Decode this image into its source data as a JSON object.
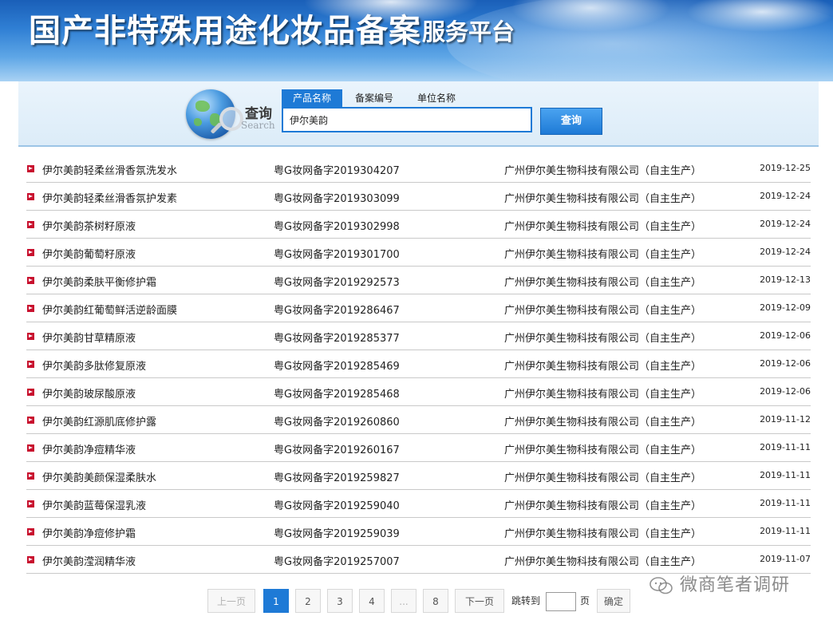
{
  "header": {
    "title": "国产非特殊用途化妆品备案",
    "subtitle": "服务平台"
  },
  "search": {
    "label": "查询",
    "label_en": "Search",
    "tabs": [
      {
        "label": "产品名称",
        "active": true
      },
      {
        "label": "备案编号",
        "active": false
      },
      {
        "label": "单位名称",
        "active": false
      }
    ],
    "query": "伊尔美韵",
    "button_label": "查询"
  },
  "results": [
    {
      "name": "伊尔美韵轻柔丝滑香氛洗发水",
      "code": "粤G妆网备字2019304207",
      "company": "广州伊尔美生物科技有限公司（自主生产）",
      "date": "2019-12-25"
    },
    {
      "name": "伊尔美韵轻柔丝滑香氛护发素",
      "code": "粤G妆网备字2019303099",
      "company": "广州伊尔美生物科技有限公司（自主生产）",
      "date": "2019-12-24"
    },
    {
      "name": "伊尔美韵茶树籽原液",
      "code": "粤G妆网备字2019302998",
      "company": "广州伊尔美生物科技有限公司（自主生产）",
      "date": "2019-12-24"
    },
    {
      "name": "伊尔美韵葡萄籽原液",
      "code": "粤G妆网备字2019301700",
      "company": "广州伊尔美生物科技有限公司（自主生产）",
      "date": "2019-12-24"
    },
    {
      "name": "伊尔美韵柔肤平衡修护霜",
      "code": "粤G妆网备字2019292573",
      "company": "广州伊尔美生物科技有限公司（自主生产）",
      "date": "2019-12-13"
    },
    {
      "name": "伊尔美韵红葡萄鲜活逆龄面膜",
      "code": "粤G妆网备字2019286467",
      "company": "广州伊尔美生物科技有限公司（自主生产）",
      "date": "2019-12-09"
    },
    {
      "name": "伊尔美韵甘草精原液",
      "code": "粤G妆网备字2019285377",
      "company": "广州伊尔美生物科技有限公司（自主生产）",
      "date": "2019-12-06"
    },
    {
      "name": "伊尔美韵多肽修复原液",
      "code": "粤G妆网备字2019285469",
      "company": "广州伊尔美生物科技有限公司（自主生产）",
      "date": "2019-12-06"
    },
    {
      "name": "伊尔美韵玻尿酸原液",
      "code": "粤G妆网备字2019285468",
      "company": "广州伊尔美生物科技有限公司（自主生产）",
      "date": "2019-12-06"
    },
    {
      "name": "伊尔美韵红源肌底修护露",
      "code": "粤G妆网备字2019260860",
      "company": "广州伊尔美生物科技有限公司（自主生产）",
      "date": "2019-11-12"
    },
    {
      "name": "伊尔美韵净痘精华液",
      "code": "粤G妆网备字2019260167",
      "company": "广州伊尔美生物科技有限公司（自主生产）",
      "date": "2019-11-11"
    },
    {
      "name": "伊尔美韵美颜保湿柔肤水",
      "code": "粤G妆网备字2019259827",
      "company": "广州伊尔美生物科技有限公司（自主生产）",
      "date": "2019-11-11"
    },
    {
      "name": "伊尔美韵蓝莓保湿乳液",
      "code": "粤G妆网备字2019259040",
      "company": "广州伊尔美生物科技有限公司（自主生产）",
      "date": "2019-11-11"
    },
    {
      "name": "伊尔美韵净痘修护霜",
      "code": "粤G妆网备字2019259039",
      "company": "广州伊尔美生物科技有限公司（自主生产）",
      "date": "2019-11-11"
    },
    {
      "name": "伊尔美韵滢润精华液",
      "code": "粤G妆网备字2019257007",
      "company": "广州伊尔美生物科技有限公司（自主生产）",
      "date": "2019-11-07"
    }
  ],
  "pagination": {
    "prev_label": "上一页",
    "pages": [
      "1",
      "2",
      "3",
      "4",
      "...",
      "8"
    ],
    "current_page": "1",
    "next_label": "下一页",
    "jump_label": "跳转到",
    "page_unit": "页",
    "confirm_label": "确定"
  },
  "watermark": {
    "text": "微商笔者调研"
  },
  "colors": {
    "accent": "#1e7ad6",
    "bullet": "#c8102e",
    "row_divider": "#c9c9c9"
  }
}
